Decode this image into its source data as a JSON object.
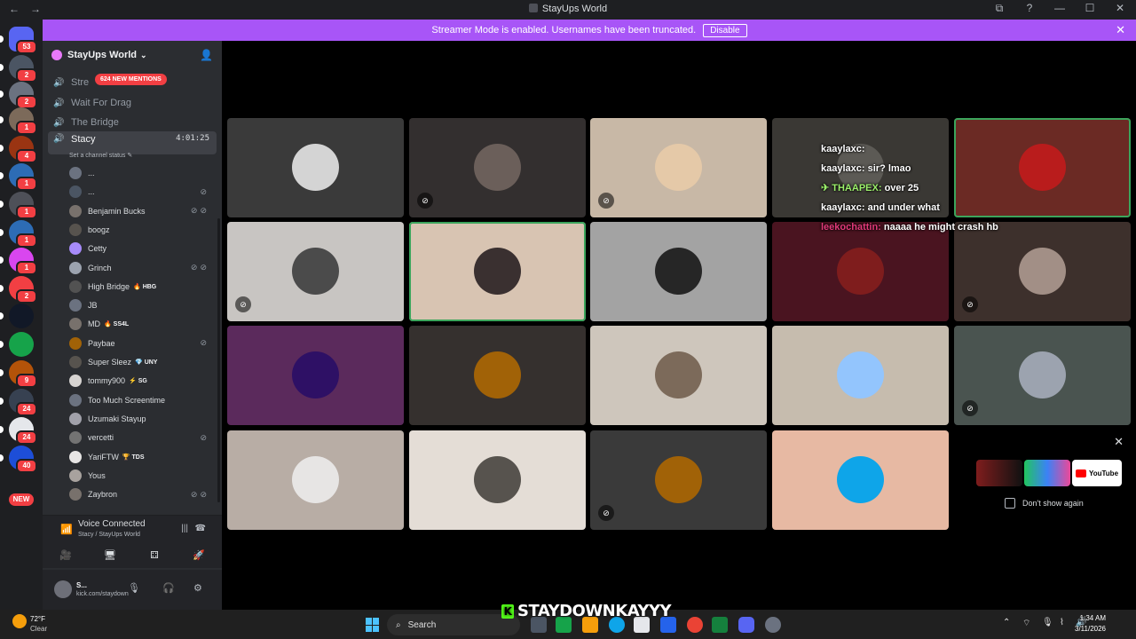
{
  "window": {
    "title": "StayUps World",
    "back": "←",
    "forward": "→",
    "controls": [
      "⧉",
      "?",
      "—",
      "☐",
      "✕"
    ]
  },
  "streamer": {
    "message": "Streamer Mode is enabled. Usernames have been truncated.",
    "disable_label": "Disable"
  },
  "rail": {
    "servers": [
      {
        "color": "#5865f2",
        "badge": "53"
      },
      {
        "color": "#4b5563",
        "badge": "2"
      },
      {
        "color": "#6b7280",
        "badge": "2"
      },
      {
        "color": "#7c6a5a",
        "badge": "1"
      },
      {
        "color": "#9a3412",
        "badge": "4"
      },
      {
        "color": "#2d6cb5",
        "badge": "1"
      },
      {
        "color": "#4e5058",
        "badge": "1"
      },
      {
        "color": "#2d6cb5",
        "badge": "1"
      },
      {
        "color": "#d946ef",
        "badge": "1"
      },
      {
        "color": "#f23f43",
        "badge": "2"
      },
      {
        "color": "#111827",
        "badge": ""
      },
      {
        "color": "#16a34a",
        "badge": ""
      },
      {
        "color": "#b45309",
        "badge": "9"
      },
      {
        "color": "#374151",
        "badge": "24"
      },
      {
        "color": "#e5e7eb",
        "badge": "24"
      },
      {
        "color": "#1d4ed8",
        "badge": "40"
      }
    ],
    "new_label": "NEW"
  },
  "sidebar": {
    "server_name": "StayUps World",
    "mentions_label": "624 NEW MENTIONS",
    "channels": [
      {
        "name": "Stre",
        "active": false
      },
      {
        "name": "Wait For Drag",
        "active": false
      },
      {
        "name": "The Bridge",
        "active": false
      },
      {
        "name": "Stacy",
        "active": true,
        "timer": "4:01:25"
      }
    ],
    "channel_status": "Set a channel status",
    "members": [
      {
        "name": "...",
        "tag": "",
        "color": "#6b7280",
        "status": ""
      },
      {
        "name": "...",
        "tag": "",
        "color": "#4b5563",
        "status": "⊘"
      },
      {
        "name": "Benjamin Bucks",
        "tag": "",
        "color": "#78716c",
        "status": "⊘⊘"
      },
      {
        "name": "boogz",
        "tag": "",
        "color": "#57534e",
        "status": ""
      },
      {
        "name": "Cetty",
        "tag": "",
        "color": "#a78bfa",
        "status": ""
      },
      {
        "name": "Grinch",
        "tag": "",
        "color": "#9ca3af",
        "status": "⊘⊘"
      },
      {
        "name": "High Bridge",
        "tag": "🔥 HBG",
        "color": "#525252",
        "status": ""
      },
      {
        "name": "JB",
        "tag": "",
        "color": "#6b7280",
        "status": ""
      },
      {
        "name": "MD",
        "tag": "🔥 SS4L",
        "color": "#78716c",
        "status": ""
      },
      {
        "name": "Paybae",
        "tag": "",
        "color": "#a16207",
        "status": "⊘"
      },
      {
        "name": "Super Sleez",
        "tag": "💎 UNY",
        "color": "#57534e",
        "status": ""
      },
      {
        "name": "tommy900",
        "tag": "⚡ SG",
        "color": "#d6d3d1",
        "status": ""
      },
      {
        "name": "Too Much Screentime",
        "tag": "",
        "color": "#6b7280",
        "status": ""
      },
      {
        "name": "Uzumaki Stayup",
        "tag": "",
        "color": "#a1a1aa",
        "status": ""
      },
      {
        "name": "vercetti",
        "tag": "",
        "color": "#737373",
        "status": "⊘"
      },
      {
        "name": "YariFTW",
        "tag": "🏆 TDS",
        "color": "#e7e5e4",
        "status": ""
      },
      {
        "name": "Yous",
        "tag": "",
        "color": "#a8a29e",
        "status": ""
      },
      {
        "name": "Zaybron",
        "tag": "",
        "color": "#78716c",
        "status": "⊘⊘"
      }
    ]
  },
  "voice": {
    "status": "Voice Connected",
    "location": "Stacy / StayUps World",
    "buttons": [
      "🎥",
      "🖥",
      "⚃",
      "🚀"
    ]
  },
  "user": {
    "name": "S...",
    "status": "kick.com/staydown"
  },
  "tiles": [
    {
      "bg": "#3a3a3a",
      "avatar": "#d4d4d4",
      "muted": "",
      "speaking": false
    },
    {
      "bg": "#332f2f",
      "avatar": "#6b5f5a",
      "muted": "⊘",
      "speaking": false
    },
    {
      "bg": "#c8b8a6",
      "avatar": "#e5c9a8",
      "muted": "⊘",
      "speaking": false
    },
    {
      "bg": "#3a3834",
      "avatar": "#5c5a55",
      "muted": "",
      "speaking": false
    },
    {
      "bg": "#6b2a24",
      "avatar": "#b91c1c",
      "muted": "",
      "speaking": true
    },
    {
      "bg": "#c8c5c2",
      "avatar": "#4b4b4b",
      "muted": "⊘",
      "speaking": false
    },
    {
      "bg": "#d8c4b2",
      "avatar": "#3a3030",
      "muted": "",
      "speaking": true
    },
    {
      "bg": "#a3a3a3",
      "avatar": "#262626",
      "muted": "",
      "speaking": false
    },
    {
      "bg": "#4a1420",
      "avatar": "#7f1d1d",
      "muted": "",
      "speaking": false
    },
    {
      "bg": "#3d302c",
      "avatar": "#a28f86",
      "muted": "⊘",
      "speaking": false
    },
    {
      "bg": "#5b2a5c",
      "avatar": "#2e1065",
      "muted": "",
      "speaking": false
    },
    {
      "bg": "#35302e",
      "avatar": "#a16207",
      "muted": "",
      "speaking": false
    },
    {
      "bg": "#cec6bc",
      "avatar": "#7c6a5a",
      "muted": "",
      "speaking": false
    },
    {
      "bg": "#c6bcae",
      "avatar": "#93c5fd",
      "muted": "",
      "speaking": false
    },
    {
      "bg": "#4a5450",
      "avatar": "#9ca3af",
      "muted": "⊘",
      "speaking": false
    },
    {
      "bg": "#b8ada5",
      "avatar": "#e7e5e4",
      "muted": "",
      "speaking": false
    },
    {
      "bg": "#e4ddd6",
      "avatar": "#57534e",
      "muted": "",
      "speaking": false
    },
    {
      "bg": "#3a3a3a",
      "avatar": "#a16207",
      "muted": "⊘",
      "speaking": false
    },
    {
      "bg": "#e7b9a3",
      "avatar": "#0ea5e9",
      "muted": "",
      "speaking": false
    }
  ],
  "chat": [
    {
      "user": "kaaylaxc:",
      "text": "",
      "cls": ""
    },
    {
      "user": "kaaylaxc:",
      "text": "sir? lmao",
      "cls": ""
    },
    {
      "user": "✈ THAAPEX:",
      "text": "over 25",
      "cls": "thaa"
    },
    {
      "user": "kaaylaxc:",
      "text": "and under what",
      "cls": ""
    },
    {
      "user": "leekochattin:",
      "text": "naaaa he might crash hb",
      "cls": "leek"
    }
  ],
  "promo": {
    "youtube": "YouTube",
    "dont_show": "Don't show again",
    "close": "✕"
  },
  "taskbar": {
    "temp": "72°F",
    "cond": "Clear",
    "search": "Search",
    "time": "1:34 AM",
    "date": "3/11/2026"
  },
  "brand": {
    "text": "STAYDOWNKAYYY",
    "k": "K"
  }
}
